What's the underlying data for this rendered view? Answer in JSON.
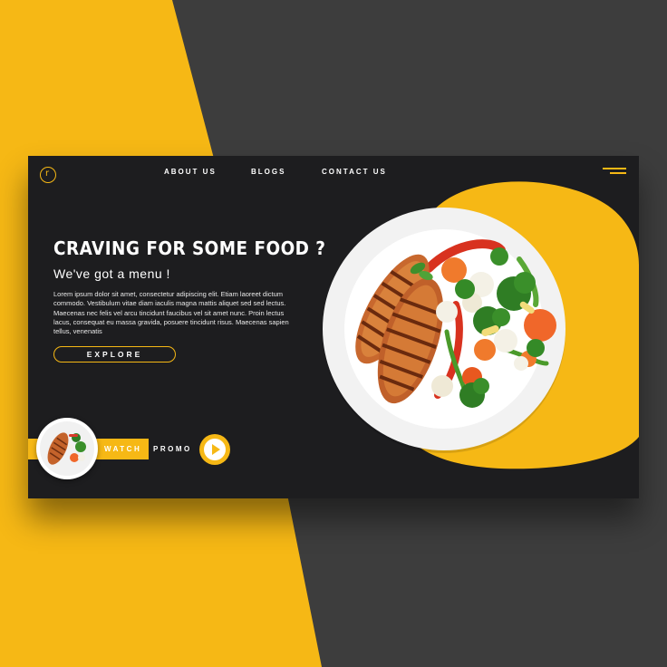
{
  "logo": {
    "glyph": "r"
  },
  "nav": {
    "links": [
      {
        "label": "ABOUT US"
      },
      {
        "label": "BLOGS"
      },
      {
        "label": "CONTACT US"
      }
    ],
    "menu_icon": "hamburger-menu-icon"
  },
  "hero": {
    "title": "CRAVING FOR SOME FOOD ?",
    "subtitle": "We've got a menu !",
    "body": "Lorem ipsum dolor sit amet, consectetur adipiscing elit. Etiam laoreet dictum commodo. Vestibulum vitae diam iaculis magna mattis aliquet sed sed lectus. Maecenas nec felis vel arcu tincidunt faucibus vel sit amet nunc. Proin lectus lacus, consequat eu massa gravida, posuere tincidunt risus. Maecenas sapien tellus, venenatis",
    "cta_label": "EXPLORE"
  },
  "promo": {
    "watch_label": "WATCH",
    "promo_label": "PROMO",
    "play_icon": "play-icon"
  },
  "colors": {
    "accent": "#f6b815",
    "card_bg": "#1d1d1f",
    "page_dark": "#3d3d3d"
  }
}
